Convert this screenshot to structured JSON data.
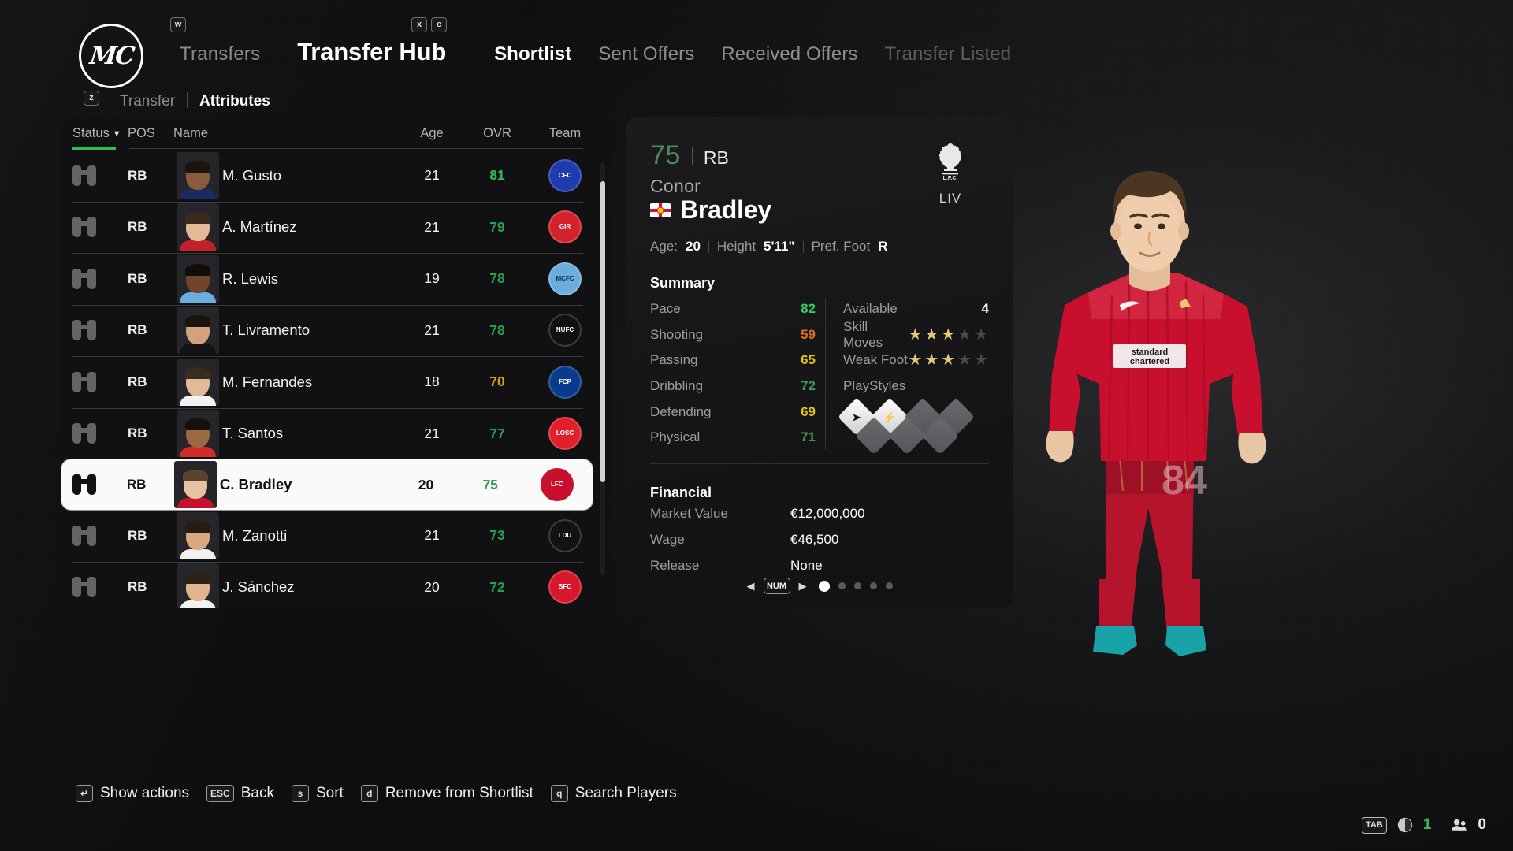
{
  "header": {
    "club_monogram": "MC",
    "breadcrumb_parent": "Transfers",
    "breadcrumb_parent_key": "w",
    "title": "Transfer Hub",
    "tabs": [
      {
        "label": "Shortlist",
        "key": "x",
        "state": "active"
      },
      {
        "label": "Sent Offers",
        "key": "c",
        "state": "normal"
      },
      {
        "label": "Received Offers",
        "key": "",
        "state": "normal"
      },
      {
        "label": "Transfer Listed",
        "key": "",
        "state": "disabled"
      }
    ],
    "subtabs_key": "z",
    "subtabs": [
      {
        "label": "Transfer",
        "state": "normal"
      },
      {
        "label": "Attributes",
        "state": "active"
      }
    ]
  },
  "list": {
    "columns": [
      "Status",
      "POS",
      "Name",
      "Age",
      "OVR",
      "Team"
    ],
    "sort_caret": "▼",
    "rows": [
      {
        "status_icon": "binoculars-icon",
        "pos": "RB",
        "name": "M. Gusto",
        "age": "21",
        "ovr": "81",
        "ovr_color": "#2fbf5a",
        "team": "Chelsea",
        "crest_bg": "#1f3bad",
        "crest_fg": "#ffffff",
        "crest_text": "CFC",
        "skin": "#8a5a3c",
        "hair": "#1d1410",
        "kit": "#1b2a63",
        "selected": false
      },
      {
        "status_icon": "binoculars-icon",
        "pos": "RB",
        "name": "A. Martínez",
        "age": "21",
        "ovr": "79",
        "ovr_color": "#2f9e4f",
        "team": "Girona",
        "crest_bg": "#d2232a",
        "crest_fg": "#ffffff",
        "crest_text": "GIR",
        "skin": "#e3b997",
        "hair": "#3a2a1c",
        "kit": "#c2202a",
        "selected": false
      },
      {
        "status_icon": "binoculars-icon",
        "pos": "RB",
        "name": "R. Lewis",
        "age": "19",
        "ovr": "78",
        "ovr_color": "#2f9e4f",
        "team": "Manchester City",
        "crest_bg": "#6caddf",
        "crest_fg": "#0b2a4a",
        "crest_text": "MCFC",
        "skin": "#70452c",
        "hair": "#120d0a",
        "kit": "#6caddf",
        "selected": false
      },
      {
        "status_icon": "binoculars-icon",
        "pos": "RB",
        "name": "T. Livramento",
        "age": "21",
        "ovr": "78",
        "ovr_color": "#2f9e4f",
        "team": "Newcastle",
        "crest_bg": "#111113",
        "crest_fg": "#ffffff",
        "crest_text": "NUFC",
        "skin": "#d3a27d",
        "hair": "#171310",
        "kit": "#111214",
        "selected": false
      },
      {
        "status_icon": "binoculars-icon",
        "pos": "RB",
        "name": "M. Fernandes",
        "age": "18",
        "ovr": "70",
        "ovr_color": "#d6a318",
        "team": "Porto",
        "crest_bg": "#0a3a8c",
        "crest_fg": "#ffffff",
        "crest_text": "FCP",
        "skin": "#e0bb99",
        "hair": "#3a2c20",
        "kit": "#f2f2f2",
        "selected": false
      },
      {
        "status_icon": "binoculars-icon",
        "pos": "RB",
        "name": "T. Santos",
        "age": "21",
        "ovr": "77",
        "ovr_color": "#2f9e4f",
        "team": "Lille",
        "crest_bg": "#e0202a",
        "crest_fg": "#ffffff",
        "crest_text": "LOSC",
        "skin": "#9b6a45",
        "hair": "#161009",
        "kit": "#d42a2a",
        "selected": false
      },
      {
        "status_icon": "binoculars-icon",
        "pos": "RB",
        "name": "C. Bradley",
        "age": "20",
        "ovr": "75",
        "ovr_color": "#2f9e4f",
        "team": "Liverpool",
        "crest_bg": "#c8102e",
        "crest_fg": "#ffffff",
        "crest_text": "LFC",
        "skin": "#e8c3a2",
        "hair": "#5c4330",
        "kit": "#c8102e",
        "selected": true
      },
      {
        "status_icon": "binoculars-icon",
        "pos": "RB",
        "name": "M. Zanotti",
        "age": "21",
        "ovr": "73",
        "ovr_color": "#2f9e4f",
        "team": "LDU Quito",
        "crest_bg": "#121214",
        "crest_fg": "#ffffff",
        "crest_text": "LDU",
        "skin": "#d9a87f",
        "hair": "#2a1c12",
        "kit": "#f0f0f0",
        "selected": false
      },
      {
        "status_icon": "binoculars-icon",
        "pos": "RB",
        "name": "J. Sánchez",
        "age": "20",
        "ovr": "72",
        "ovr_color": "#2f9e4f",
        "team": "Sevilla",
        "crest_bg": "#d8182a",
        "crest_fg": "#ffffff",
        "crest_text": "SFC",
        "skin": "#e0b48d",
        "hair": "#2d2018",
        "kit": "#f2f2f2",
        "selected": false
      }
    ]
  },
  "detail": {
    "overall": "75",
    "position": "RB",
    "first_name": "Conor",
    "last_name": "Bradley",
    "nationality_flag": "northern-ireland-flag",
    "meta": {
      "age_label": "Age:",
      "age": "20",
      "height_label": "Height",
      "height": "5'11\"",
      "foot_label": "Pref. Foot",
      "foot": "R"
    },
    "club_abbr": "LIV",
    "club_crest": "liverbird-crest",
    "summary_title": "Summary",
    "summary_left": [
      {
        "label": "Pace",
        "value": "82",
        "color": "#2fd05f"
      },
      {
        "label": "Shooting",
        "value": "59",
        "color": "#d9701e"
      },
      {
        "label": "Passing",
        "value": "65",
        "color": "#e3c018"
      },
      {
        "label": "Dribbling",
        "value": "72",
        "color": "#3f9a55"
      },
      {
        "label": "Defending",
        "value": "69",
        "color": "#e3c018"
      },
      {
        "label": "Physical",
        "value": "71",
        "color": "#3f9a55"
      }
    ],
    "summary_right": {
      "available_label": "Available",
      "available_value": "4",
      "skill_moves_label": "Skill Moves",
      "skill_moves": 3,
      "weak_foot_label": "Weak Foot",
      "weak_foot": 3,
      "star_max": 5,
      "playstyles_label": "PlayStyles",
      "playstyles": [
        {
          "filled": true,
          "icon": "whipped-pass-icon"
        },
        {
          "filled": true,
          "icon": "quick-step-icon"
        },
        {
          "filled": false,
          "icon": ""
        },
        {
          "filled": false,
          "icon": ""
        },
        {
          "filled": false,
          "icon": ""
        },
        {
          "filled": false,
          "icon": ""
        },
        {
          "filled": false,
          "icon": ""
        }
      ]
    },
    "financial_title": "Financial",
    "financial": [
      {
        "label": "Market Value",
        "value": "€12,000,000"
      },
      {
        "label": "Wage",
        "value": "€46,500"
      },
      {
        "label": "Release",
        "value": "None"
      }
    ],
    "pager": {
      "key": "NUM",
      "left_arrow": "◀",
      "right_arrow": "▶",
      "pages": 5,
      "current": 1
    }
  },
  "bottom_hints": [
    {
      "key": "↵",
      "label": "Show actions"
    },
    {
      "key": "ESC",
      "label": "Back"
    },
    {
      "key": "s",
      "label": "Sort"
    },
    {
      "key": "d",
      "label": "Remove from Shortlist"
    },
    {
      "key": "q",
      "label": "Search Players"
    }
  ],
  "statusbar": {
    "key": "TAB",
    "volume_icon": "speaker-icon",
    "volume_value": "1",
    "players_icon": "people-icon",
    "players_value": "0"
  },
  "colors": {
    "accent_green": "#2fbf5a",
    "panel_bg": "#111113",
    "card_bg": "#18181b",
    "selected_row_bg": "#fafafa"
  }
}
